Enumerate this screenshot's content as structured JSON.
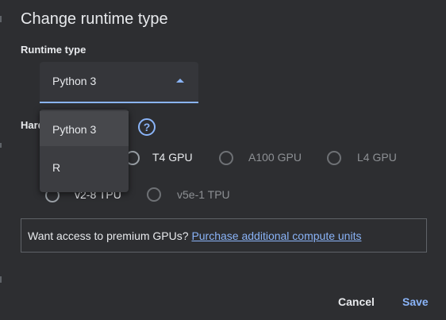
{
  "dialog": {
    "title": "Change runtime type"
  },
  "runtime": {
    "label": "Runtime type",
    "selected": "Python 3",
    "options": [
      "Python 3",
      "R"
    ]
  },
  "hardware": {
    "label_partial": "Hard",
    "options": [
      {
        "label": "T4 GPU",
        "available": true
      },
      {
        "label": "A100 GPU",
        "available": false
      },
      {
        "label": "L4 GPU",
        "available": false
      },
      {
        "label": "v2-8 TPU",
        "available": true
      },
      {
        "label": "v5e-1 TPU",
        "available": false
      }
    ]
  },
  "info": {
    "text": "Want access to premium GPUs? ",
    "link": "Purchase additional compute units"
  },
  "actions": {
    "cancel": "Cancel",
    "save": "Save"
  },
  "colors": {
    "background": "#2d2e31",
    "accent": "#8ab4f8",
    "text": "#e8eaed",
    "dim_text": "#8d9094"
  },
  "icons": {
    "help": "help-circle-icon",
    "dropdown_arrow": "triangle-up-icon"
  }
}
